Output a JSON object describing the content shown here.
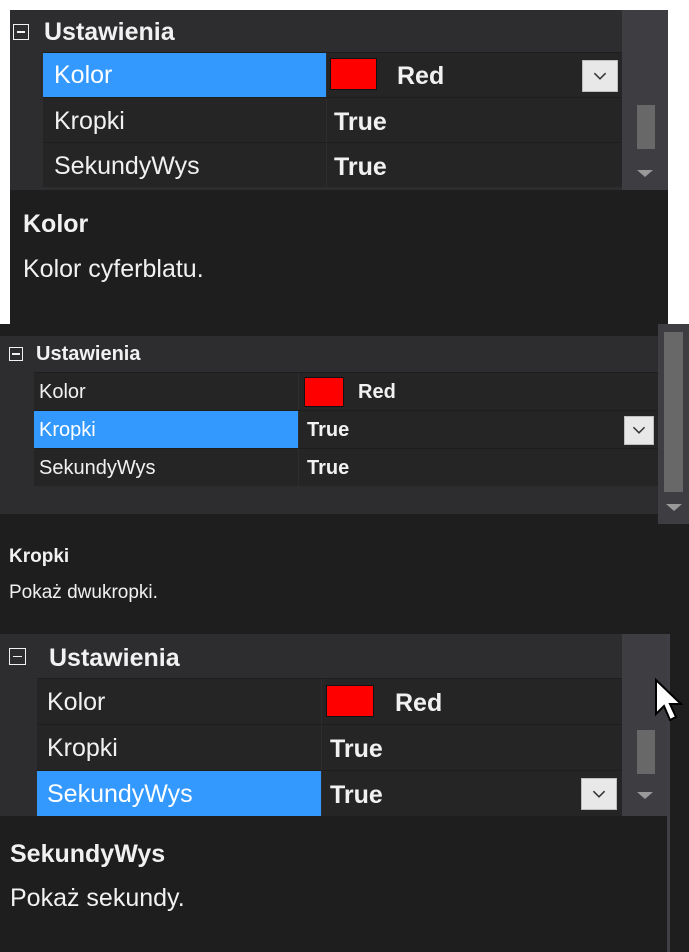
{
  "colors": {
    "selection": "#3399ff",
    "background": "#1e1e1e",
    "category": "#2d2d30",
    "swatch": "#ff0000"
  },
  "icons": {
    "collapse": "minus-box-icon",
    "dropdown": "chevron-down-icon",
    "scroll_down": "triangle-down-icon",
    "cursor": "mouse-pointer-icon"
  },
  "panels": [
    {
      "category": "Ustawienia",
      "rows": [
        {
          "name": "Kolor",
          "value": "Red"
        },
        {
          "name": "Kropki",
          "value": "True"
        },
        {
          "name": "SekundyWys",
          "value": "True"
        }
      ],
      "selected_row": "Kolor",
      "description": {
        "title": "Kolor",
        "text": "Kolor cyferblatu."
      }
    },
    {
      "category": "Ustawienia",
      "rows": [
        {
          "name": "Kolor",
          "value": "Red"
        },
        {
          "name": "Kropki",
          "value": "True"
        },
        {
          "name": "SekundyWys",
          "value": "True"
        }
      ],
      "selected_row": "Kropki",
      "description": {
        "title": "Kropki",
        "text": "Pokaż dwukropki."
      }
    },
    {
      "category": "Ustawienia",
      "rows": [
        {
          "name": "Kolor",
          "value": "Red"
        },
        {
          "name": "Kropki",
          "value": "True"
        },
        {
          "name": "SekundyWys",
          "value": "True"
        }
      ],
      "selected_row": "SekundyWys",
      "description": {
        "title": "SekundyWys",
        "text": "Pokaż sekundy."
      }
    }
  ]
}
